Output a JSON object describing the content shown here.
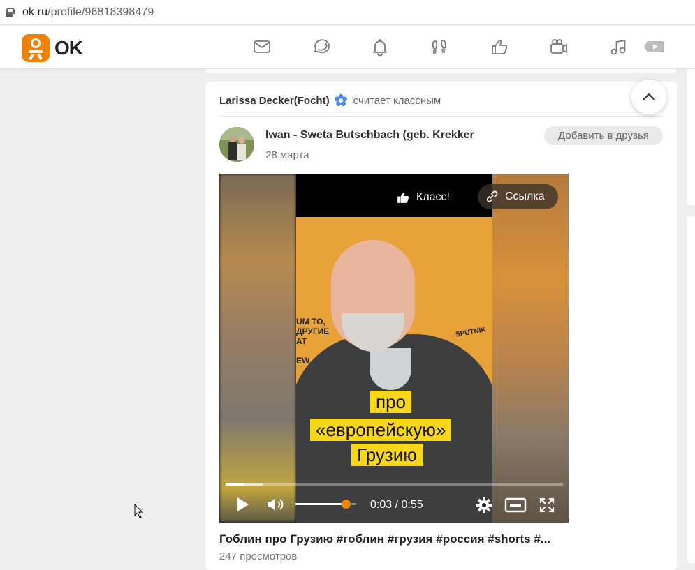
{
  "browser": {
    "url_host": "ok.ru",
    "url_path": "/profile/96818398479"
  },
  "header": {
    "logo_text": "OK",
    "brand_color": "#ee8208"
  },
  "nav_icons": [
    "mail-icon",
    "discussions-icon",
    "notifications-icon",
    "guests-icon",
    "likes-icon",
    "video-calls-icon",
    "music-icon",
    "video-icon"
  ],
  "activity": {
    "user": "Larissa Decker(Focht)",
    "action": "считает классным"
  },
  "post": {
    "author": "Iwan - Sweta Butschbach (geb. Krekker",
    "date": "28 марта",
    "add_friend_label": "Добавить в друзья",
    "video": {
      "like_label": "Класс!",
      "link_label": "Ссылка",
      "caption_line1": "про",
      "caption_line2": "«европейскую»",
      "caption_line3": "Грузию",
      "background_sign": "UM TO,\nДРУГИЕ\nAT\nEW",
      "background_logo": "SPUTNIK",
      "time": "0:03 / 0:55",
      "progress_played": 0.055,
      "progress_buffered": 0.11,
      "volume_level": 0.84
    },
    "title": "Гоблин про Грузию #гоблин #грузия #россия #shorts #...",
    "views": "247 просмотров"
  }
}
